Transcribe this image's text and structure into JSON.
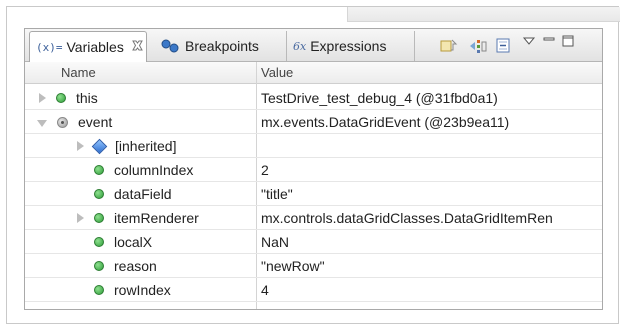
{
  "tabs": [
    {
      "label": "Variables",
      "icon": "variables-icon",
      "icon_text": "(x)=",
      "active": true
    },
    {
      "label": "Breakpoints",
      "icon": "breakpoints-icon",
      "active": false
    },
    {
      "label": "Expressions",
      "icon": "expressions-icon",
      "icon_text": "6x",
      "active": false
    }
  ],
  "toolbar": [
    "show-type-names-icon",
    "show-logical-structure-icon",
    "collapse-all-icon",
    "view-menu-icon",
    "minimize-icon",
    "maximize-icon"
  ],
  "columns": {
    "name": "Name",
    "value": "Value"
  },
  "rows": [
    {
      "name": "this",
      "value": "TestDrive_test_debug_4 (@31fbd0a1)",
      "icon": "green-dot",
      "expander": "collapsed",
      "indent": 0
    },
    {
      "name": "event",
      "value": "mx.events.DataGridEvent (@23b9ea11)",
      "icon": "gray-dot",
      "expander": "expanded",
      "indent": 0
    },
    {
      "name": "[inherited]",
      "value": "",
      "icon": "blue-diamond",
      "expander": "collapsed",
      "indent": 1
    },
    {
      "name": "columnIndex",
      "value": "2",
      "icon": "green-dot",
      "expander": "none",
      "indent": 1
    },
    {
      "name": "dataField",
      "value": "\"title\"",
      "icon": "green-dot",
      "expander": "none",
      "indent": 1
    },
    {
      "name": "itemRenderer",
      "value": "mx.controls.dataGridClasses.DataGridItemRen",
      "icon": "green-dot",
      "expander": "collapsed",
      "indent": 1
    },
    {
      "name": "localX",
      "value": "NaN",
      "icon": "green-dot",
      "expander": "none",
      "indent": 1
    },
    {
      "name": "reason",
      "value": "\"newRow\"",
      "icon": "green-dot",
      "expander": "none",
      "indent": 1
    },
    {
      "name": "rowIndex",
      "value": "4",
      "icon": "green-dot",
      "expander": "none",
      "indent": 1
    }
  ],
  "colors": {
    "accent_green": "#2f9e3a",
    "diamond_blue": "#2f6fd0",
    "border": "#a9a9a9"
  }
}
